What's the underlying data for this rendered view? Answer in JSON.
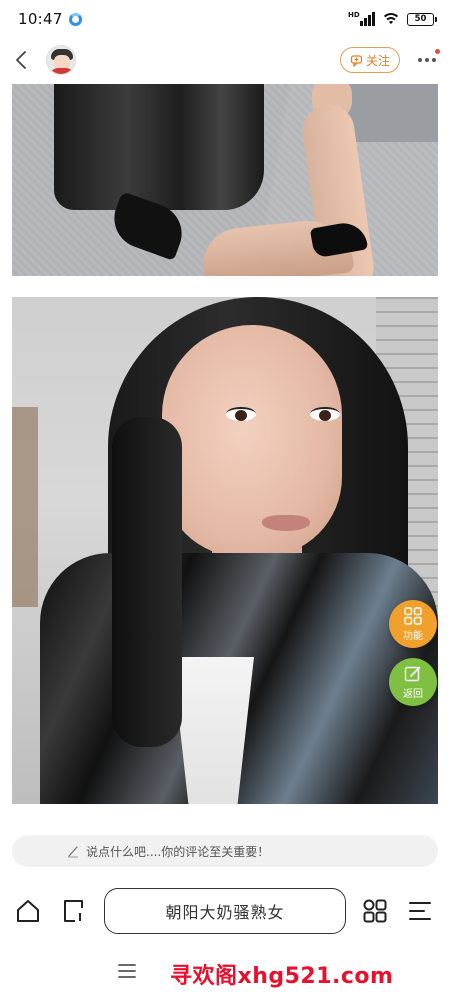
{
  "status_bar": {
    "time": "10:47",
    "network_label": "HD",
    "battery": "50"
  },
  "nav": {
    "follow_label": "关注"
  },
  "fab": {
    "function_label": "功能",
    "back_label": "返回",
    "function_color": "#f0a02c",
    "back_color": "#7fc043"
  },
  "comment": {
    "placeholder": "说点什么吧....你的评论至关重要！"
  },
  "toolbar": {
    "url_text": "朝阳大奶骚熟女"
  },
  "watermark": {
    "text": "寻欢阁xhg521.com",
    "color": "#e8112d"
  },
  "icons": [
    "back-icon",
    "avatar",
    "follow-icon",
    "more-icon",
    "grid-icon",
    "edit-icon",
    "home-icon",
    "tab-icon",
    "menu-icon"
  ]
}
